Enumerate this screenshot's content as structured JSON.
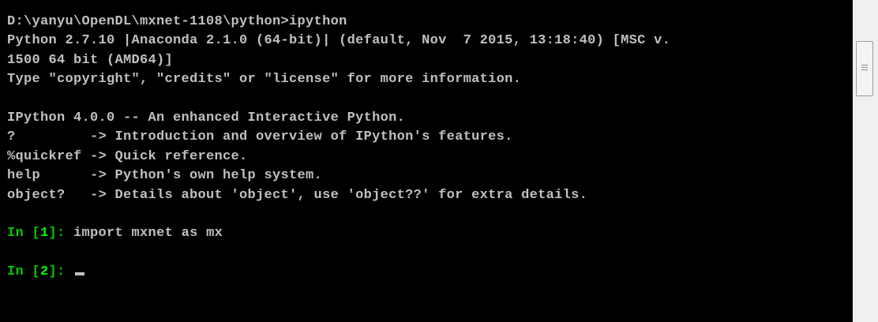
{
  "console": {
    "lines": [
      "D:\\yanyu\\OpenDL\\mxnet-1108\\python>ipython",
      "Python 2.7.10 |Anaconda 2.1.0 (64-bit)| (default, Nov  7 2015, 13:18:40) [MSC v.",
      "1500 64 bit (AMD64)]",
      "Type \"copyright\", \"credits\" or \"license\" for more information.",
      "",
      "IPython 4.0.0 -- An enhanced Interactive Python.",
      "?         -> Introduction and overview of IPython's features.",
      "%quickref -> Quick reference.",
      "help      -> Python's own help system.",
      "object?   -> Details about 'object', use 'object??' for extra details.",
      ""
    ],
    "in1": {
      "prompt_label": "In [",
      "prompt_num": "1",
      "prompt_close": "]: ",
      "command": "import mxnet as mx"
    },
    "in2": {
      "prompt_label": "In [",
      "prompt_num": "2",
      "prompt_close": "]: "
    }
  },
  "colors": {
    "background": "#000000",
    "text": "#c0c0c0",
    "prompt": "#00c800",
    "prompt_number": "#00ff00"
  }
}
